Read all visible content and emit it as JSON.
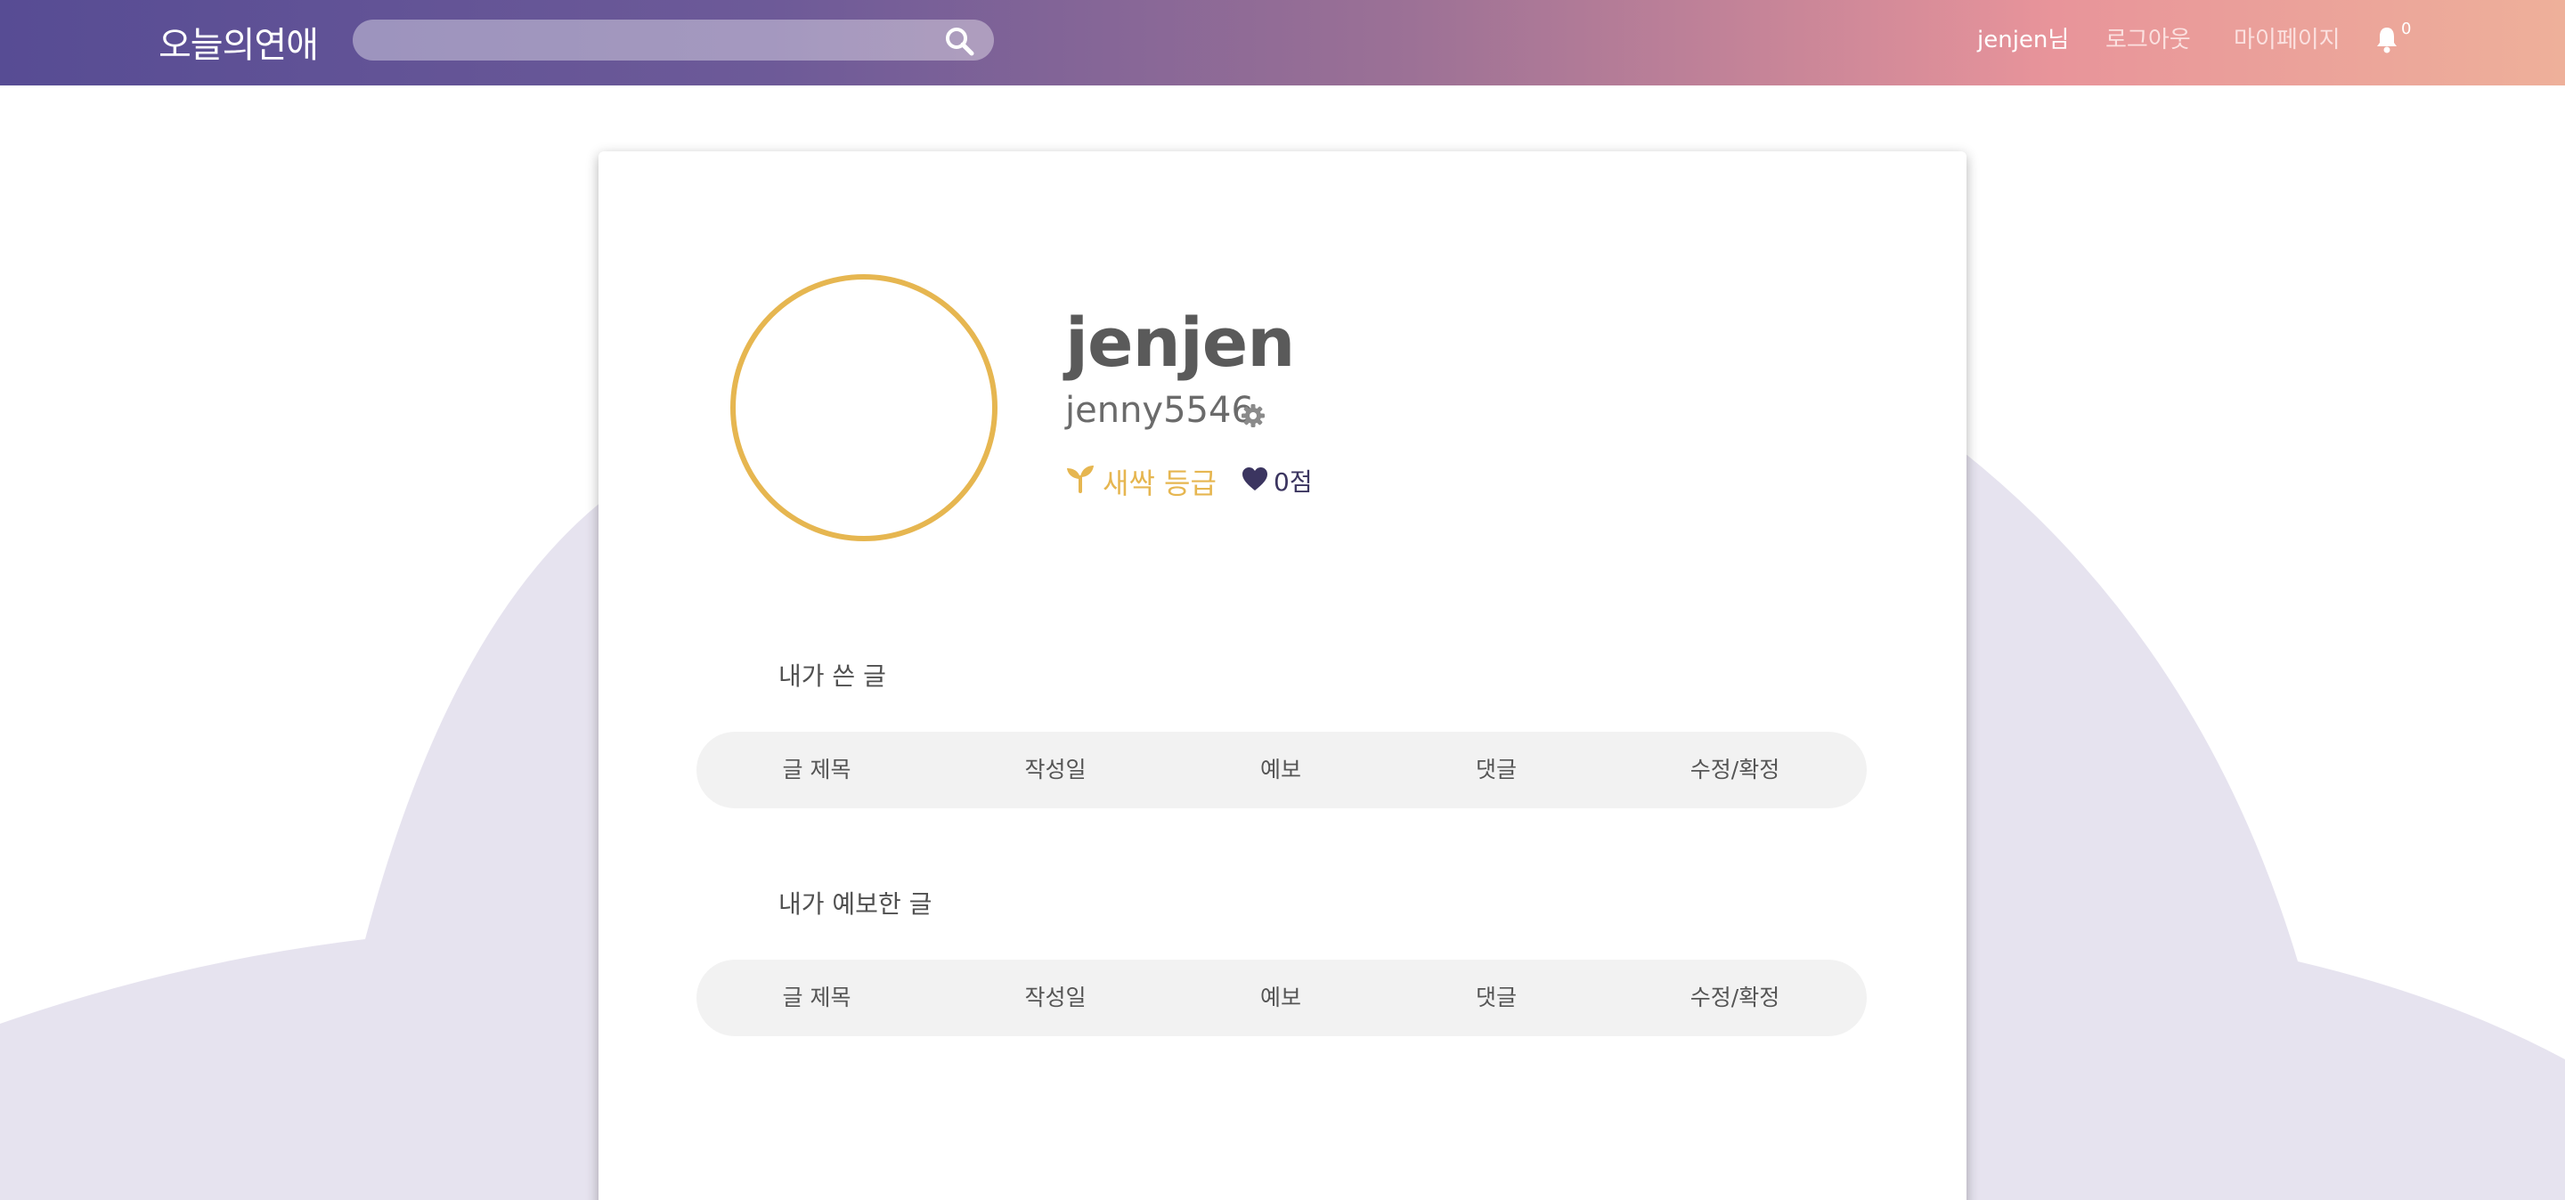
{
  "navbar": {
    "logo": "오늘의연애",
    "search": {
      "placeholder": "",
      "value": ""
    },
    "user_greeting": "jenjen님",
    "logout": "로그아웃",
    "mypage": "마이페이지",
    "notification_count": "0"
  },
  "profile": {
    "nickname": "jenjen",
    "user_id": "jenny5546",
    "grade": "새싹 등급",
    "points": "0점"
  },
  "sections": [
    {
      "title": "내가 쓴 글",
      "columns": [
        "글 제목",
        "작성일",
        "예보",
        "댓글",
        "수정/확정"
      ]
    },
    {
      "title": "내가 예보한 글",
      "columns": [
        "글 제목",
        "작성일",
        "예보",
        "댓글",
        "수정/확정"
      ]
    }
  ],
  "colors": {
    "accent_gold": "#e6b650",
    "accent_purple": "#3b3560",
    "background_shape": "#e6e3ef",
    "navbar_start": "#574c94",
    "navbar_end": "#eeb09a"
  }
}
